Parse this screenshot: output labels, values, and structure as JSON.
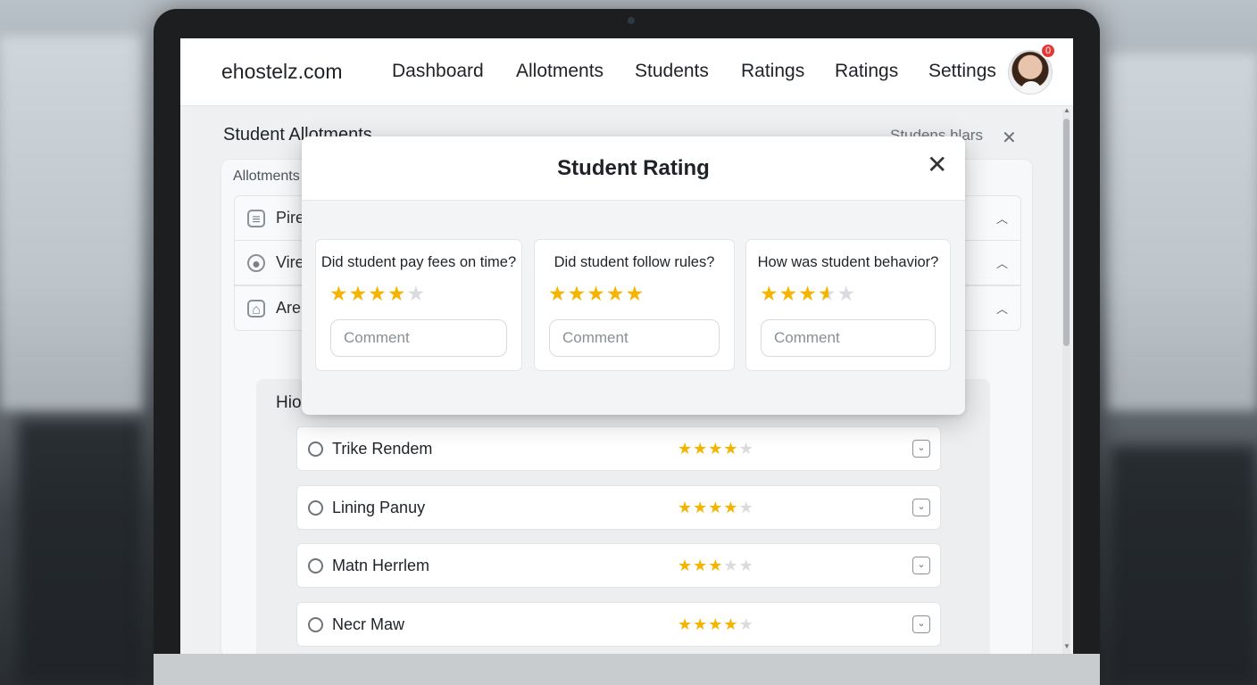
{
  "nav": {
    "brand": "ehostelz.com",
    "items": [
      "Dashboard",
      "Allotments",
      "Students",
      "Ratings",
      "Ratings",
      "Settings"
    ],
    "notification_count": "0"
  },
  "page": {
    "title": "Student Allotments",
    "right_text": "Studens hlars",
    "panel_label": "Allotments",
    "accordion": [
      {
        "label": "Pire",
        "icon": "document-icon"
      },
      {
        "label": "Vire",
        "icon": "user-icon"
      },
      {
        "label": "Are",
        "icon": "building-icon"
      }
    ],
    "history_label": "Hio",
    "rows": [
      {
        "name": "Trike Rendem",
        "rating": 4
      },
      {
        "name": "Lining Panuy",
        "rating": 4
      },
      {
        "name": "Matn Herrlem",
        "rating": 3
      },
      {
        "name": "Necr Maw",
        "rating": 4
      }
    ]
  },
  "modal": {
    "title": "Student Rating",
    "questions": [
      {
        "text": "Did student pay fees on time?",
        "rating": 4,
        "comment_placeholder": "Comment"
      },
      {
        "text": "Did student follow rules?",
        "rating": 5,
        "comment_placeholder": "Comment"
      },
      {
        "text": "How was student behavior?",
        "rating": 3.5,
        "comment_placeholder": "Comment"
      }
    ]
  },
  "colors": {
    "star": "#f4b400",
    "star_empty": "#d9dbde",
    "badge": "#e53935"
  }
}
